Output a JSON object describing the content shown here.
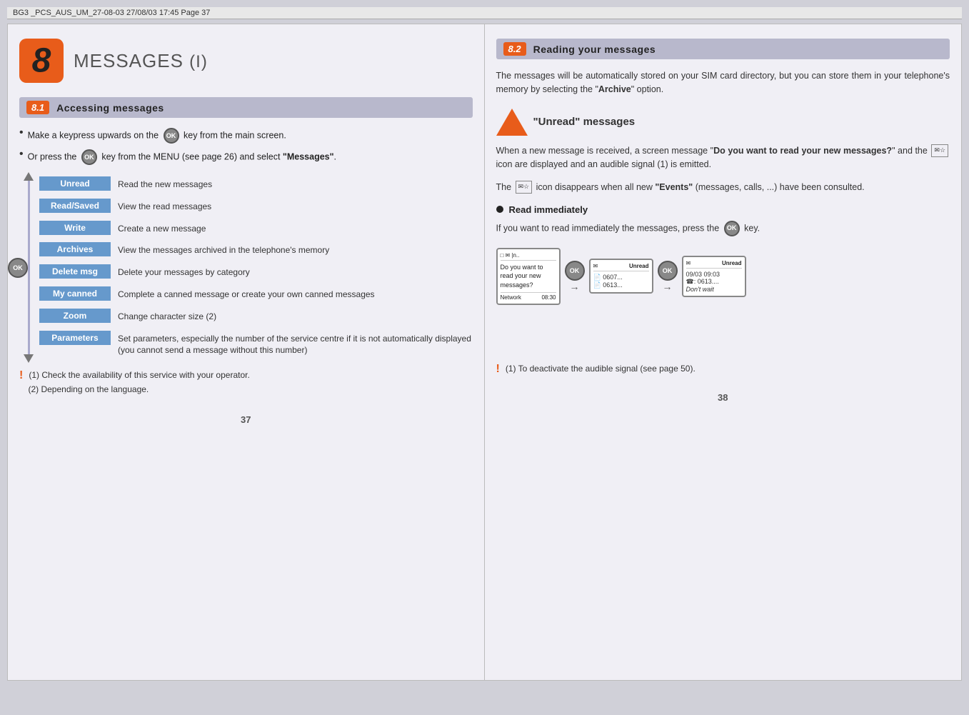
{
  "doc_header": "BG3 _PCS_AUS_UM_27-08-03   27/08/03   17:45   Page 37",
  "chapter": {
    "number": "8",
    "title": "MESSAGES",
    "subtitle": "(I)"
  },
  "section_8_1": {
    "badge": "8.1",
    "title": "Accessing messages",
    "bullets": [
      "Make a keypress upwards on the   key from the main screen.",
      "Or press the   key from the MENU (see page 26) and select \"Messages\"."
    ],
    "menu_items": [
      {
        "label": "Unread",
        "desc": "Read the new messages"
      },
      {
        "label": "Read/Saved",
        "desc": "View the read messages"
      },
      {
        "label": "Write",
        "desc": "Create a new message"
      },
      {
        "label": "Archives",
        "desc": "View the messages archived in the telephone's memory"
      },
      {
        "label": "Delete msg",
        "desc": "Delete your messages by category"
      },
      {
        "label": "My canned",
        "desc": "Complete a canned message or create your own canned messages"
      },
      {
        "label": "Zoom",
        "desc": "Change character size (2)"
      },
      {
        "label": "Parameters",
        "desc": "Set parameters, especially the number of the service centre if it is not automatically displayed (you cannot send a message without this number)"
      }
    ],
    "footnotes": [
      "(1) Check the availability of this service with your operator.",
      "(2) Depending on the language."
    ]
  },
  "page_left": "37",
  "section_8_2": {
    "badge": "8.2",
    "title": "Reading your messages",
    "intro": "The messages will be automatically stored on your SIM card directory, but you can store them in your telephone's memory by selecting the \"Archive\" option.",
    "unread_section": {
      "title": "\"Unread\" messages",
      "body1": "When a new message is received, a screen message \"Do you want to read your new messages?\" and the   icon are displayed and an audible signal (1) is emitted.",
      "body2": "The   icon disappears when all new \"Events\" (messages, calls, ...) have been consulted."
    },
    "read_immediately": {
      "title": "Read immediately",
      "body": "If you want to read immediately the messages, press the   key."
    },
    "screens": [
      {
        "id": "screen1",
        "header_icons": "□ ☎ |n..",
        "title": "Do you want to read your new messages?",
        "footer": "Network   08:30"
      },
      {
        "id": "screen2",
        "title": "Unread",
        "rows": [
          "0607...",
          "0613..."
        ]
      },
      {
        "id": "screen3",
        "title": "Unread",
        "rows": [
          "09/03 09:03",
          ": 0613....",
          "Don't wait"
        ]
      }
    ],
    "footnote": "(1) To deactivate the audible signal (see page 50)."
  },
  "page_right": "38"
}
